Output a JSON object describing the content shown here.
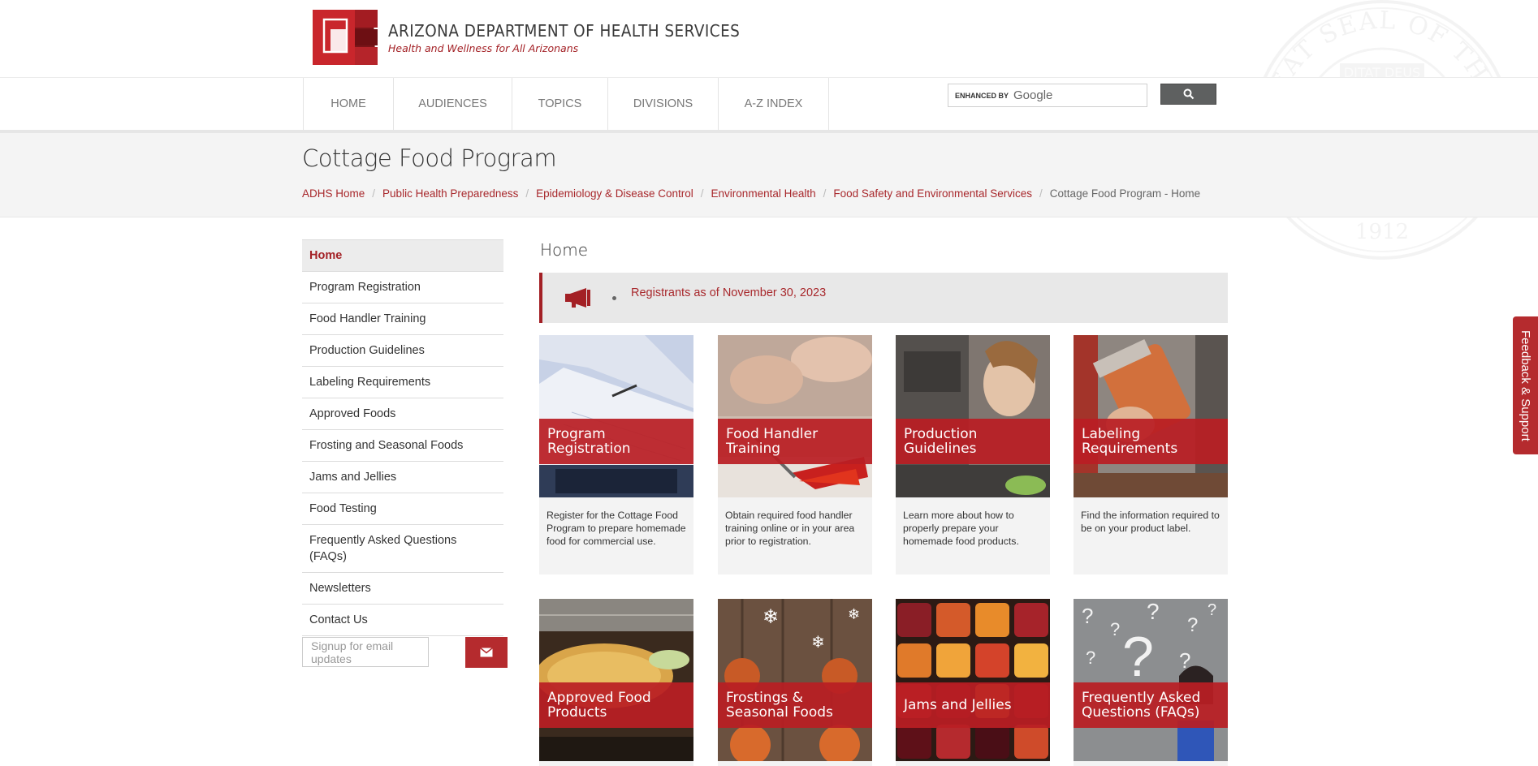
{
  "header": {
    "org_name": "ARIZONA DEPARTMENT OF HEALTH SERVICES",
    "tagline": "Health and Wellness for All Arizonans",
    "seal_text": "GREAT SEAL OF THE STATE OF ARIZONA",
    "seal_motto": "DITAT DEUS",
    "seal_year": "1912"
  },
  "nav": {
    "items": [
      {
        "label": "HOME"
      },
      {
        "label": "AUDIENCES"
      },
      {
        "label": "TOPICS"
      },
      {
        "label": "DIVISIONS"
      },
      {
        "label": "A-Z INDEX"
      }
    ],
    "search": {
      "enhanced_label": "ENHANCED BY",
      "brand": "Google",
      "button_icon": "search-icon"
    }
  },
  "page": {
    "title": "Cottage Food Program",
    "breadcrumb": [
      {
        "label": "ADHS Home"
      },
      {
        "label": "Public Health Preparedness"
      },
      {
        "label": "Epidemiology & Disease Control"
      },
      {
        "label": "Environmental Health"
      },
      {
        "label": "Food Safety and Environmental Services"
      },
      {
        "label": "Cottage Food Program - Home"
      }
    ]
  },
  "sidebar": {
    "items": [
      {
        "label": "Home"
      },
      {
        "label": "Program Registration"
      },
      {
        "label": "Food Handler Training"
      },
      {
        "label": "Production Guidelines"
      },
      {
        "label": "Labeling Requirements"
      },
      {
        "label": "Approved Foods"
      },
      {
        "label": "Frosting and Seasonal Foods"
      },
      {
        "label": "Jams and Jellies"
      },
      {
        "label": "Food Testing"
      },
      {
        "label": "Frequently Asked Questions (FAQs)"
      },
      {
        "label": "Newsletters"
      },
      {
        "label": "Contact Us"
      }
    ],
    "signup_placeholder": "Signup for email updates",
    "signup_icon": "envelope-icon"
  },
  "content": {
    "title": "Home",
    "alert": {
      "icon": "megaphone-icon",
      "text": "Registrants as of November 30, 2023"
    },
    "cards": [
      {
        "label": "Program Registration",
        "desc": "Register for the Cottage Food Program to prepare homemade food for commercial use."
      },
      {
        "label": "Food Handler Training",
        "desc": "Obtain required food handler training online or in your area prior to registration."
      },
      {
        "label": "Production Guidelines",
        "desc": "Learn more about how to properly prepare your homemade food products."
      },
      {
        "label": "Labeling Requirements",
        "desc": "Find the information required to be on your product label."
      },
      {
        "label": "Approved Food Products",
        "desc": ""
      },
      {
        "label": "Frostings & Seasonal Foods",
        "desc": ""
      },
      {
        "label": "Jams and Jellies",
        "desc": ""
      },
      {
        "label": "Frequently Asked Questions (FAQs)",
        "desc": ""
      }
    ]
  },
  "feedback": {
    "label": "Feedback & Support"
  },
  "colors": {
    "brand_red": "#a32025",
    "button_red": "#b52b2e",
    "nav_text": "#777777",
    "band_bg": "#f4f4f4"
  }
}
